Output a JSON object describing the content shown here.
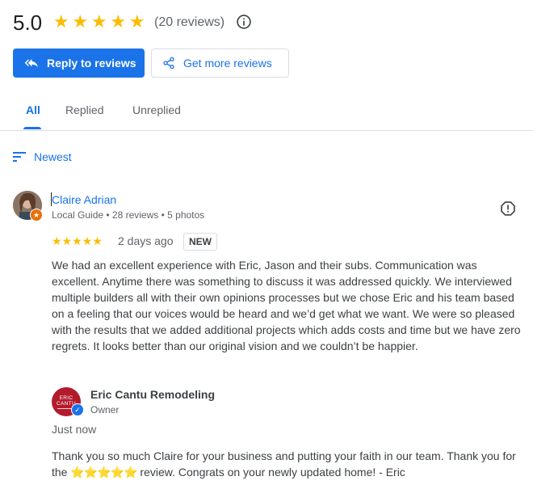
{
  "summary": {
    "rating": "5.0",
    "stars": [
      "★",
      "★",
      "★",
      "★",
      "★"
    ],
    "review_count": "(20 reviews)",
    "info_icon": "info-icon"
  },
  "actions": {
    "reply_label": "Reply to reviews",
    "reply_icon": "reply-all-icon",
    "more_label": "Get more reviews",
    "more_icon": "share-icon"
  },
  "tabs": [
    {
      "label": "All",
      "active": true
    },
    {
      "label": "Replied",
      "active": false
    },
    {
      "label": "Unreplied",
      "active": false
    }
  ],
  "sort": {
    "label": "Newest",
    "icon": "sort-icon"
  },
  "review": {
    "name": "Claire Adrian",
    "meta": "Local Guide • 28 reviews • 5 photos",
    "rating": 5,
    "stars": "★★★★★",
    "date": "2 days ago",
    "badge": "NEW",
    "text": "We had an excellent experience with Eric, Jason and their subs. Communication was excellent. Anytime there was something to discuss it was addressed quickly. We interviewed multiple builders all with their own opinions processes but we chose Eric and his team based on a feeling that our voices would be heard and we’d get what we want. We were so pleased with the results that we added additional projects which adds costs and time but we have zero regrets. It looks better than our original vision and we couldn’t be happier."
  },
  "reply": {
    "owner_name": "Eric Cantu Remodeling",
    "owner_role": "Owner",
    "logo_line1": "ERIC",
    "logo_line2": "CANTU",
    "time": "Just now",
    "text_before": "Thank you so much Claire for your business and putting your faith in our team. Thank you for the ",
    "emoji_stars": "⭐⭐⭐⭐⭐",
    "text_after": " review. Congrats on your newly updated home! - Eric"
  },
  "colors": {
    "accent": "#1a73e8",
    "star": "#fbbc04",
    "local_guide_badge": "#e8710a",
    "owner_logo": "#b31b2c"
  }
}
